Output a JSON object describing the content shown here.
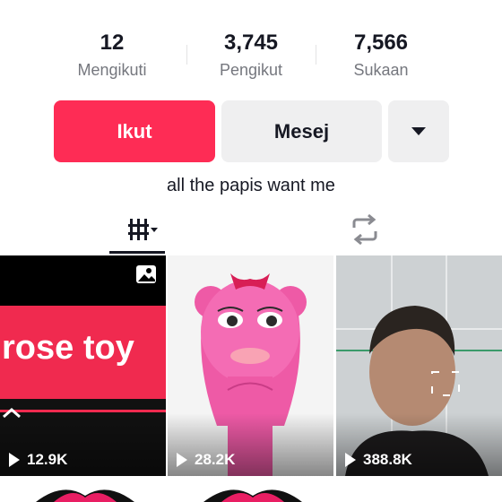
{
  "stats": [
    {
      "value": "12",
      "label": "Mengikuti"
    },
    {
      "value": "3,745",
      "label": "Pengikut"
    },
    {
      "value": "7,566",
      "label": "Sukaan"
    }
  ],
  "actions": {
    "follow_label": "Ikut",
    "message_label": "Mesej",
    "more_icon": "caret-down-icon"
  },
  "bio": "all the papis want me",
  "tabs": {
    "videos_icon": "grid-filter-icon",
    "repost_icon": "repost-icon"
  },
  "videos": [
    {
      "views": "12.9K",
      "overlay_text": "rose toy"
    },
    {
      "views": "28.2K"
    },
    {
      "views": "388.8K"
    }
  ],
  "colors": {
    "accent": "#fe2c55",
    "button_gray": "#efeff0",
    "text_primary": "#161823",
    "text_secondary": "#75777e"
  }
}
